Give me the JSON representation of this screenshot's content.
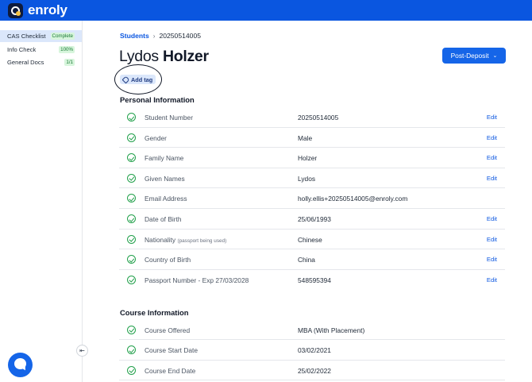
{
  "app": {
    "brand": "enroly"
  },
  "sidebar": {
    "items": [
      {
        "label": "CAS Checklist",
        "badge": "Complete",
        "active": true
      },
      {
        "label": "Info Check",
        "badge": "100%",
        "active": false
      },
      {
        "label": "General Docs",
        "badge": "1/1",
        "active": false
      }
    ]
  },
  "breadcrumb": {
    "root": "Students",
    "separator": "›",
    "current": "20250514005"
  },
  "student": {
    "first_name": "Lydos",
    "last_name": "Holzer"
  },
  "status_dropdown": {
    "label": "Post-Deposit",
    "icon": "chevron-down-icon"
  },
  "add_tag": {
    "label": "Add tag",
    "icon": "tag-icon"
  },
  "personal": {
    "title": "Personal Information",
    "rows": [
      {
        "label": "Student Number",
        "hint": "",
        "value": "20250514005",
        "edit": "Edit"
      },
      {
        "label": "Gender",
        "hint": "",
        "value": "Male",
        "edit": "Edit"
      },
      {
        "label": "Family Name",
        "hint": "",
        "value": "Holzer",
        "edit": "Edit"
      },
      {
        "label": "Given Names",
        "hint": "",
        "value": "Lydos",
        "edit": "Edit"
      },
      {
        "label": "Email Address",
        "hint": "",
        "value": "holly.ellis+20250514005@enroly.com",
        "edit": ""
      },
      {
        "label": "Date of Birth",
        "hint": "",
        "value": "25/06/1993",
        "edit": "Edit"
      },
      {
        "label": "Nationality",
        "hint": "(passport being used)",
        "value": "Chinese",
        "edit": "Edit"
      },
      {
        "label": "Country of Birth",
        "hint": "",
        "value": "China",
        "edit": "Edit"
      },
      {
        "label": "Passport Number - Exp 27/03/2028",
        "hint": "",
        "value": "548595394",
        "edit": "Edit"
      }
    ]
  },
  "course": {
    "title": "Course Information",
    "rows": [
      {
        "label": "Course Offered",
        "value": "MBA (With Placement)"
      },
      {
        "label": "Course Start Date",
        "value": "03/02/2021"
      },
      {
        "label": "Course End Date",
        "value": "25/02/2022"
      }
    ]
  },
  "colors": {
    "brand": "#0a56e0",
    "success": "#22a04b",
    "sidebar_active": "#dbe7fb"
  }
}
